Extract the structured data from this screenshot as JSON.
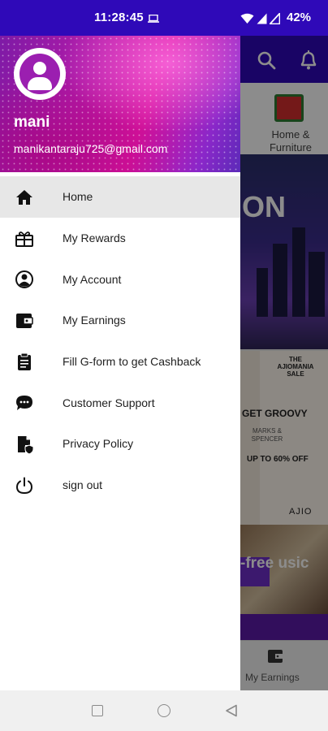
{
  "status_bar": {
    "time": "11:28:45",
    "battery": "42%"
  },
  "background_app": {
    "category_label": "Home & Furniture",
    "banner1_text": "ON",
    "banner2": {
      "tag": "THE AJIOMANIA SALE",
      "headline": "GET GROOVY",
      "brand": "MARKS & SPENCER",
      "offer": "UP TO 60% OFF",
      "footer": "AJIO"
    },
    "banner3_text": "-free usic",
    "bottom_nav_label": "My Earnings"
  },
  "drawer": {
    "user": {
      "name": "mani",
      "email": "manikantaraju725@gmail.com"
    },
    "menu": [
      {
        "label": "Home",
        "icon": "home-icon",
        "active": true
      },
      {
        "label": "My Rewards",
        "icon": "gift-icon",
        "active": false
      },
      {
        "label": "My Account",
        "icon": "account-circle-icon",
        "active": false
      },
      {
        "label": "My Earnings",
        "icon": "wallet-icon",
        "active": false
      },
      {
        "label": "Fill G-form to get Cashback",
        "icon": "clipboard-icon",
        "active": false
      },
      {
        "label": "Customer Support",
        "icon": "chat-icon",
        "active": false
      },
      {
        "label": "Privacy Policy",
        "icon": "policy-icon",
        "active": false
      },
      {
        "label": "sign out",
        "icon": "power-icon",
        "active": false
      }
    ]
  },
  "colors": {
    "primary": "#2f09b8",
    "active_item_bg": "#e7e7e7"
  }
}
